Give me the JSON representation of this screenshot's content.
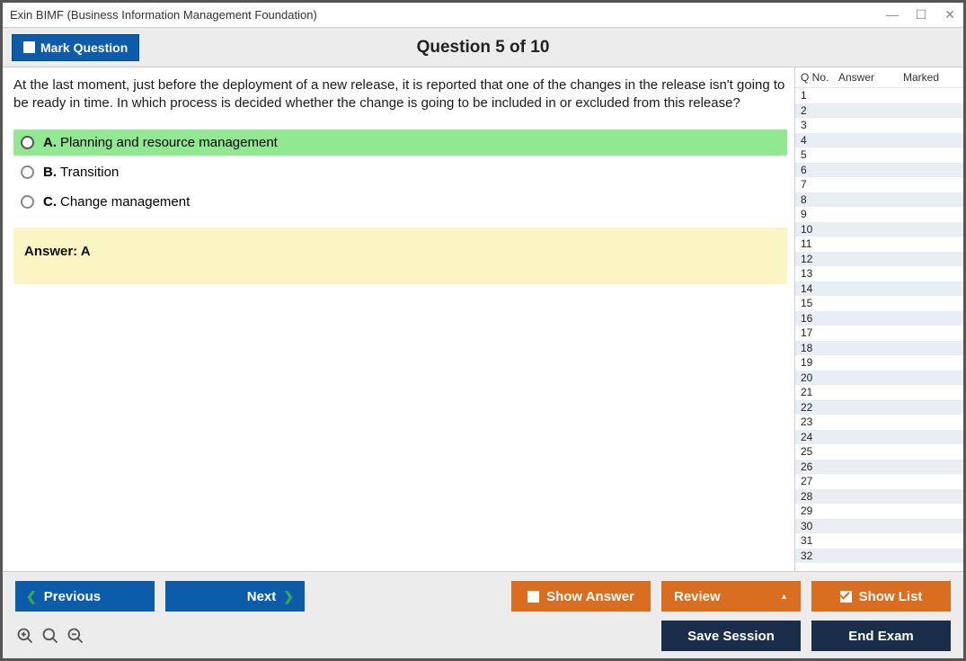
{
  "window": {
    "title": "Exin BIMF (Business Information Management Foundation)"
  },
  "header": {
    "mark_label": "Mark Question",
    "question_title": "Question 5 of 10"
  },
  "question": {
    "text": "At the last moment, just before the deployment of a new release, it is reported that one of the changes in the release isn't going to be ready in time. In which process is decided whether the change is going to be included in or excluded from this release?",
    "options": [
      {
        "letter": "A.",
        "text": "Planning and resource management",
        "selected": true
      },
      {
        "letter": "B.",
        "text": "Transition",
        "selected": false
      },
      {
        "letter": "C.",
        "text": "Change management",
        "selected": false
      }
    ],
    "answer_label": "Answer: A"
  },
  "side": {
    "h1": "Q No.",
    "h2": "Answer",
    "h3": "Marked",
    "rows": [
      "1",
      "2",
      "3",
      "4",
      "5",
      "6",
      "7",
      "8",
      "9",
      "10",
      "11",
      "12",
      "13",
      "14",
      "15",
      "16",
      "17",
      "18",
      "19",
      "20",
      "21",
      "22",
      "23",
      "24",
      "25",
      "26",
      "27",
      "28",
      "29",
      "30",
      "31",
      "32"
    ]
  },
  "footer": {
    "previous": "Previous",
    "next": "Next",
    "show_answer": "Show Answer",
    "review": "Review",
    "show_list": "Show List",
    "save_session": "Save Session",
    "end_exam": "End Exam"
  }
}
